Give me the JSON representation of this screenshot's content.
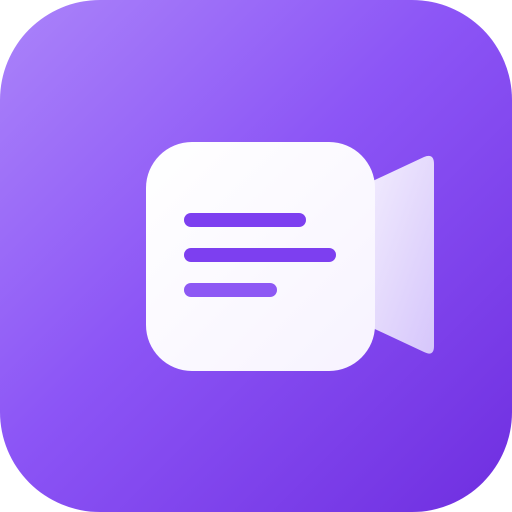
{
  "icon": {
    "name": "video-notes-app-icon",
    "glyph": "video-camera-with-text-lines",
    "colors": {
      "background_start": "#ab84fa",
      "background_mid": "#8c55f6",
      "background_end": "#6f2ee0",
      "body_fill": "#ffffff",
      "lens_fill_start": "#f3eefe",
      "lens_fill_end": "#d6c6fb",
      "line_color": "#7d3ff0"
    }
  }
}
